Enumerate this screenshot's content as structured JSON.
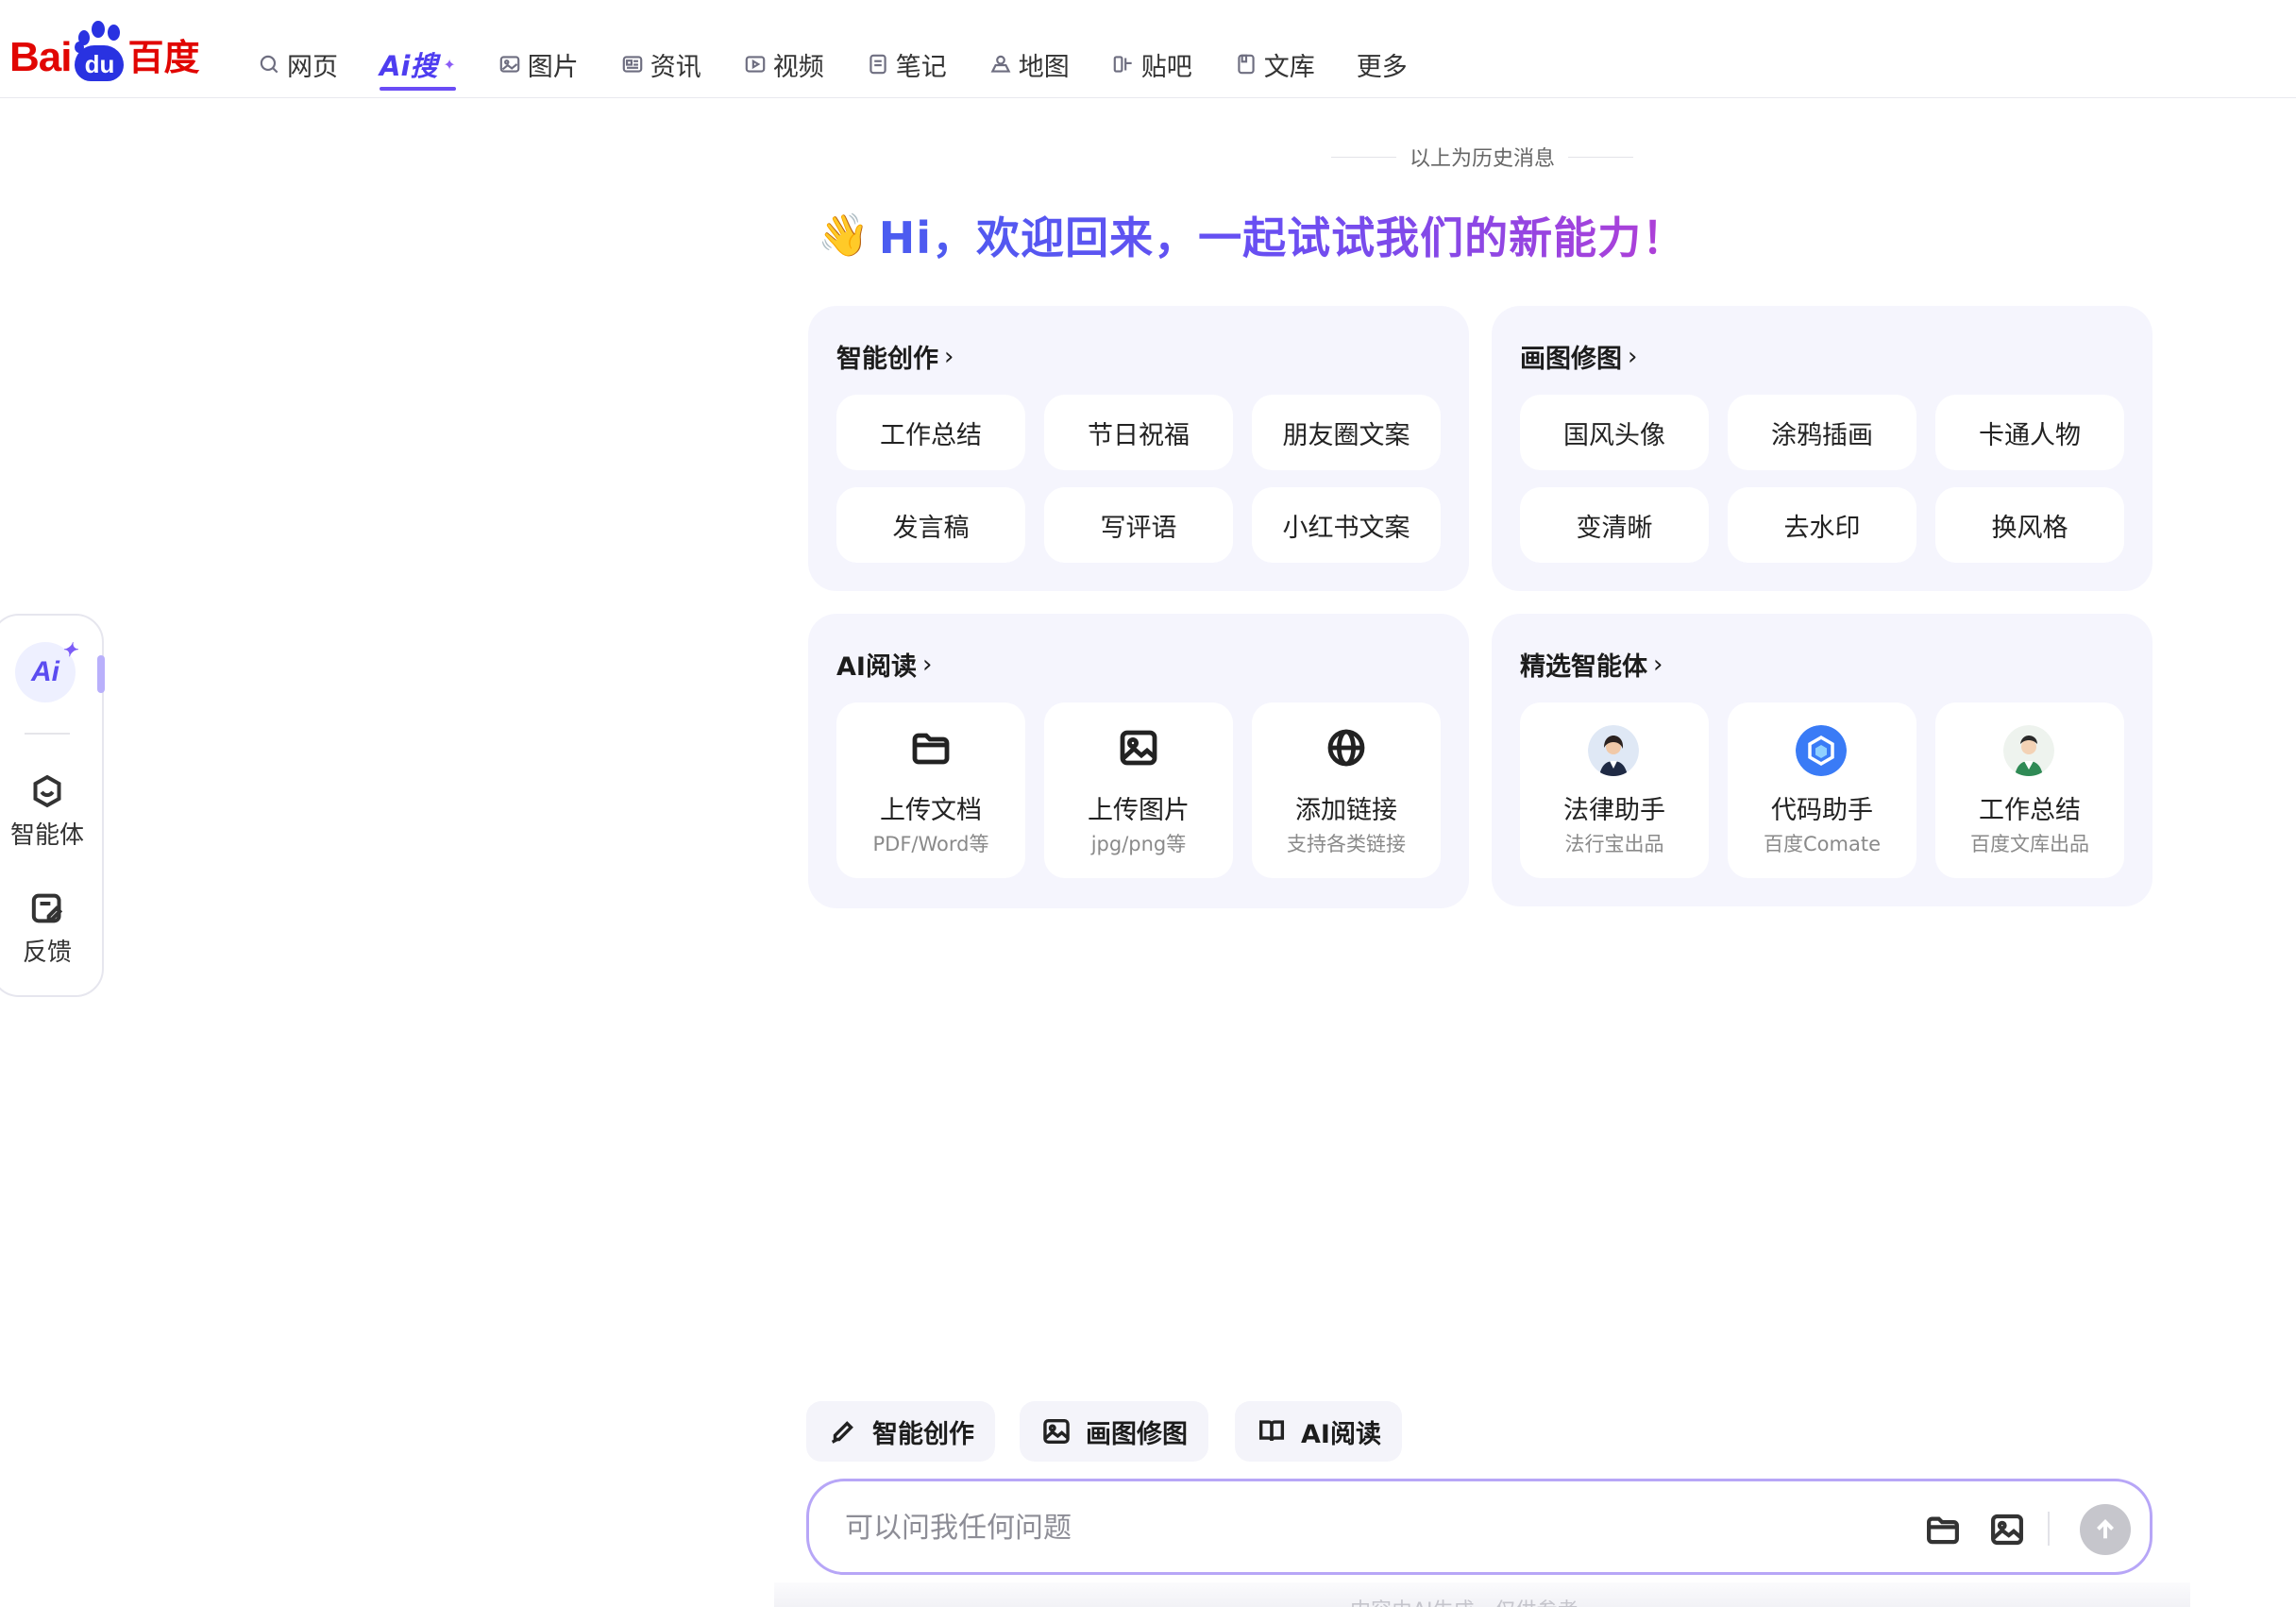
{
  "logo": {
    "text_bai": "Bai",
    "text_du": "du",
    "text_cn": "百度"
  },
  "nav": [
    {
      "label": "网页",
      "icon": "search-icon"
    },
    {
      "label": "Ai搜",
      "icon": "ai-search-logo",
      "active": true
    },
    {
      "label": "图片",
      "icon": "image-icon"
    },
    {
      "label": "资讯",
      "icon": "news-icon"
    },
    {
      "label": "视频",
      "icon": "video-icon"
    },
    {
      "label": "笔记",
      "icon": "note-icon"
    },
    {
      "label": "地图",
      "icon": "map-icon"
    },
    {
      "label": "贴吧",
      "icon": "tieba-icon"
    },
    {
      "label": "文库",
      "icon": "wenku-icon"
    },
    {
      "label": "更多"
    }
  ],
  "rail": {
    "ai_label": "Ai",
    "agent_label": "智能体",
    "feedback_label": "反馈"
  },
  "history_label": "以上为历史消息",
  "welcome": {
    "emoji": "👋",
    "text": "Hi，欢迎回来，一起试试我们的新能力！"
  },
  "cards": {
    "creation": {
      "title": "智能创作",
      "chips": [
        "工作总结",
        "节日祝福",
        "朋友圈文案",
        "发言稿",
        "写评语",
        "小红书文案"
      ]
    },
    "drawing": {
      "title": "画图修图",
      "chips": [
        "国风头像",
        "涂鸦插画",
        "卡通人物",
        "变清晰",
        "去水印",
        "换风格"
      ]
    },
    "reading": {
      "title": "AI阅读",
      "tiles": [
        {
          "title": "上传文档",
          "sub": "PDF/Word等",
          "icon": "folder-icon"
        },
        {
          "title": "上传图片",
          "sub": "jpg/png等",
          "icon": "image-icon"
        },
        {
          "title": "添加链接",
          "sub": "支持各类链接",
          "icon": "globe-icon"
        }
      ]
    },
    "agents": {
      "title": "精选智能体",
      "tiles": [
        {
          "title": "法律助手",
          "sub": "法行宝出品",
          "icon": "lawyer-avatar"
        },
        {
          "title": "代码助手",
          "sub": "百度Comate",
          "icon": "comate-logo"
        },
        {
          "title": "工作总结",
          "sub": "百度文库出品",
          "icon": "worker-avatar"
        }
      ]
    }
  },
  "quick_actions": [
    "智能创作",
    "画图修图",
    "AI阅读"
  ],
  "composer": {
    "placeholder": "可以问我任何问题"
  },
  "footer_note": "内容由AI生成，仅供参考",
  "colors": {
    "accent": "#5b4cf0",
    "brand_red": "#e10602",
    "brand_blue": "#2932e1",
    "card_bg": "#f5f5fd"
  }
}
